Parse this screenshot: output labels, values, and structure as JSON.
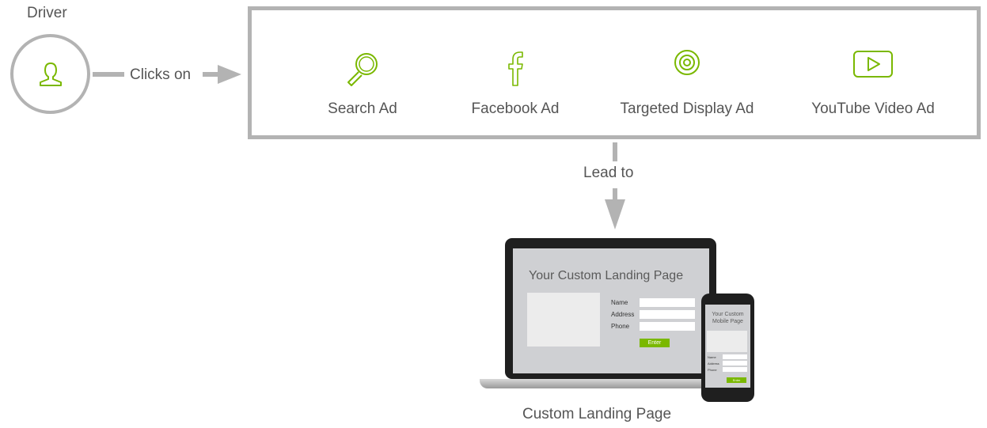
{
  "colors": {
    "accent": "#7ab800",
    "connector": "#b3b3b3"
  },
  "driver": {
    "label": "Driver",
    "icon": "user-icon"
  },
  "connector_labels": {
    "clicks_on": "Clicks on",
    "lead_to": "Lead to"
  },
  "ads": [
    {
      "label": "Search Ad",
      "icon": "magnifier-icon"
    },
    {
      "label": "Facebook Ad",
      "icon": "facebook-icon"
    },
    {
      "label": "Targeted Display Ad",
      "icon": "target-icon"
    },
    {
      "label": "YouTube Video Ad",
      "icon": "play-icon"
    }
  ],
  "landing": {
    "caption": "Custom Landing Page",
    "laptop": {
      "title": "Your Custom Landing Page",
      "fields": [
        "Name",
        "Address",
        "Phone"
      ],
      "button": "Enter"
    },
    "phone": {
      "title_line1": "Your Custom",
      "title_line2": "Mobile Page",
      "fields": [
        "Name",
        "Address",
        "Phone"
      ],
      "button": "Enter"
    }
  }
}
